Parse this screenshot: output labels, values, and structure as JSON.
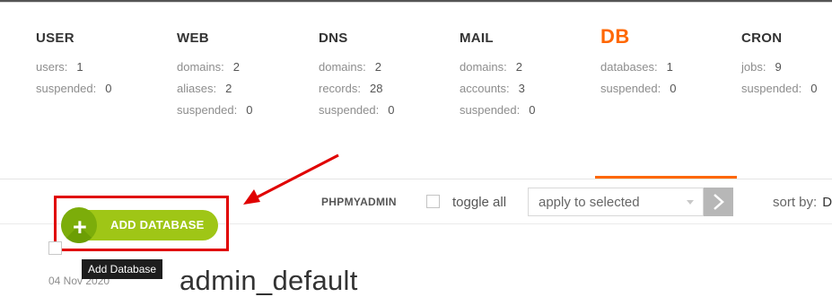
{
  "stats": [
    {
      "title": "USER",
      "rows": [
        {
          "label": "users:",
          "value": "1"
        },
        {
          "label": "suspended:",
          "value": "0"
        }
      ]
    },
    {
      "title": "WEB",
      "rows": [
        {
          "label": "domains:",
          "value": "2"
        },
        {
          "label": "aliases:",
          "value": "2"
        },
        {
          "label": "suspended:",
          "value": "0"
        }
      ]
    },
    {
      "title": "DNS",
      "rows": [
        {
          "label": "domains:",
          "value": "2"
        },
        {
          "label": "records:",
          "value": "28"
        },
        {
          "label": "suspended:",
          "value": "0"
        }
      ]
    },
    {
      "title": "MAIL",
      "rows": [
        {
          "label": "domains:",
          "value": "2"
        },
        {
          "label": "accounts:",
          "value": "3"
        },
        {
          "label": "suspended:",
          "value": "0"
        }
      ]
    },
    {
      "title": "DB",
      "rows": [
        {
          "label": "databases:",
          "value": "1"
        },
        {
          "label": "suspended:",
          "value": "0"
        }
      ]
    },
    {
      "title": "CRON",
      "rows": [
        {
          "label": "jobs:",
          "value": "9"
        },
        {
          "label": "suspended:",
          "value": "0"
        }
      ]
    }
  ],
  "toolbar": {
    "add_label": "ADD DATABASE",
    "phpmyadmin_label": "PHPMYADMIN",
    "toggle_all_label": "toggle all",
    "bulk_action_selected": "apply to selected",
    "sort_by_label": "sort by:",
    "sort_by_value": "D"
  },
  "tooltip": "Add Database",
  "list": {
    "date": "04  Nov  2020",
    "db_name": "admin_default"
  },
  "colors": {
    "accent": "#ff6701",
    "add_button": "#9fc616",
    "annotation": "#e00000"
  }
}
